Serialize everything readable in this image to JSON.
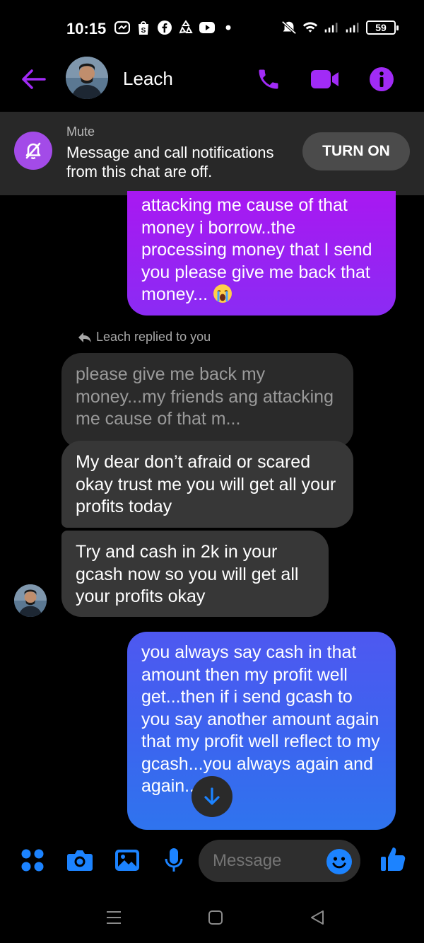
{
  "status_bar": {
    "time": "10:15",
    "battery": "59",
    "left_icons": [
      "messenger-icon",
      "shop-icon",
      "facebook-icon",
      "recycle-icon",
      "youtube-icon",
      "dot-icon"
    ],
    "right_icons": [
      "mute-icon",
      "wifi-icon",
      "signal-icon",
      "signal-icon",
      "battery-icon"
    ]
  },
  "header": {
    "contact_name": "Leach",
    "accent_color": "#a12bf6",
    "icons": [
      "back-arrow-icon",
      "phone-icon",
      "video-camera-icon",
      "info-icon"
    ]
  },
  "mute_banner": {
    "title": "Mute",
    "text": "Message and call notifications from this chat are off.",
    "button": "TURN ON"
  },
  "messages": {
    "sent_1": "attacking me cause of that money i borrow..the processing money that I send you please give me back that money...",
    "reply_note": "Leach replied to you",
    "quoted": "please give me back my money...my friends ang attacking me cause of that m...",
    "recv_1": "My dear don’t afraid or scared okay trust me you will get all your profits today",
    "recv_2": "Try and cash in 2k in your gcash now so you will get all your profits okay",
    "sent_2": "you always say cash in that amount then my profit well get...then if i send gcash to you say another amount again that my profit well reflect to my gcash...you always again and again..."
  },
  "composer": {
    "placeholder": "Message",
    "icons": [
      "menu-dots-icon",
      "camera-icon",
      "gallery-icon",
      "microphone-icon",
      "emoji-icon",
      "like-icon"
    ],
    "accent_color": "#1c83ff"
  },
  "nav_bar": {
    "icons": [
      "recents-icon",
      "home-icon",
      "back-icon"
    ]
  }
}
